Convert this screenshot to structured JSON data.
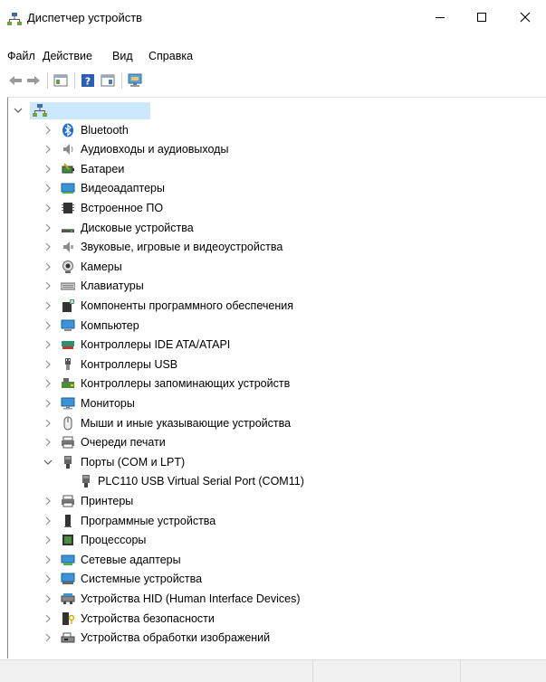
{
  "window": {
    "title": "Диспетчер устройств",
    "minimize_glyph": "—",
    "close_glyph": "✕"
  },
  "menu": [
    "Файл",
    "Действие",
    "Вид",
    "Справка"
  ],
  "toolbar": {
    "buttons": [
      "back-icon",
      "forward-icon",
      "properties-icon",
      "help-icon",
      "view-icon",
      "monitor-icon"
    ]
  },
  "tree": {
    "root_icon": "computer-network-icon",
    "items": [
      {
        "label": "Bluetooth",
        "icon": "bluetooth-icon",
        "expanded": false
      },
      {
        "label": "Аудиовходы и аудиовыходы",
        "icon": "audio-icon",
        "expanded": false
      },
      {
        "label": "Батареи",
        "icon": "battery-icon",
        "expanded": false
      },
      {
        "label": "Видеоадаптеры",
        "icon": "display-adapter-icon",
        "expanded": false
      },
      {
        "label": "Встроенное ПО",
        "icon": "firmware-icon",
        "expanded": false
      },
      {
        "label": "Дисковые устройства",
        "icon": "disk-icon",
        "expanded": false
      },
      {
        "label": "Звуковые, игровые и видеоустройства",
        "icon": "sound-icon",
        "expanded": false
      },
      {
        "label": "Камеры",
        "icon": "camera-icon",
        "expanded": false
      },
      {
        "label": "Клавиатуры",
        "icon": "keyboard-icon",
        "expanded": false
      },
      {
        "label": "Компоненты программного обеспечения",
        "icon": "software-component-icon",
        "expanded": false
      },
      {
        "label": "Компьютер",
        "icon": "computer-icon",
        "expanded": false
      },
      {
        "label": "Контроллеры IDE ATA/ATAPI",
        "icon": "ide-controller-icon",
        "expanded": false
      },
      {
        "label": "Контроллеры USB",
        "icon": "usb-icon",
        "expanded": false
      },
      {
        "label": "Контроллеры запоминающих устройств",
        "icon": "storage-controller-icon",
        "expanded": false
      },
      {
        "label": "Мониторы",
        "icon": "monitor-icon",
        "expanded": false
      },
      {
        "label": "Мыши и иные указывающие устройства",
        "icon": "mouse-icon",
        "expanded": false
      },
      {
        "label": "Очереди печати",
        "icon": "print-queue-icon",
        "expanded": false
      },
      {
        "label": "Порты (COM и LPT)",
        "icon": "port-icon",
        "expanded": true,
        "children": [
          {
            "label": "PLC110 USB Virtual Serial Port (COM11)",
            "icon": "port-icon"
          }
        ]
      },
      {
        "label": "Принтеры",
        "icon": "printer-icon",
        "expanded": false
      },
      {
        "label": "Программные устройства",
        "icon": "software-device-icon",
        "expanded": false
      },
      {
        "label": "Процессоры",
        "icon": "processor-icon",
        "expanded": false
      },
      {
        "label": "Сетевые адаптеры",
        "icon": "network-adapter-icon",
        "expanded": false
      },
      {
        "label": "Системные устройства",
        "icon": "system-device-icon",
        "expanded": false
      },
      {
        "label": "Устройства HID (Human Interface Devices)",
        "icon": "hid-icon",
        "expanded": false
      },
      {
        "label": "Устройства безопасности",
        "icon": "security-device-icon",
        "expanded": false
      },
      {
        "label": "Устройства обработки изображений",
        "icon": "imaging-device-icon",
        "expanded": false
      }
    ]
  },
  "colors": {
    "selection": "#cce8ff",
    "chevron": "#909090",
    "statusbar": "#f0f0f0"
  }
}
